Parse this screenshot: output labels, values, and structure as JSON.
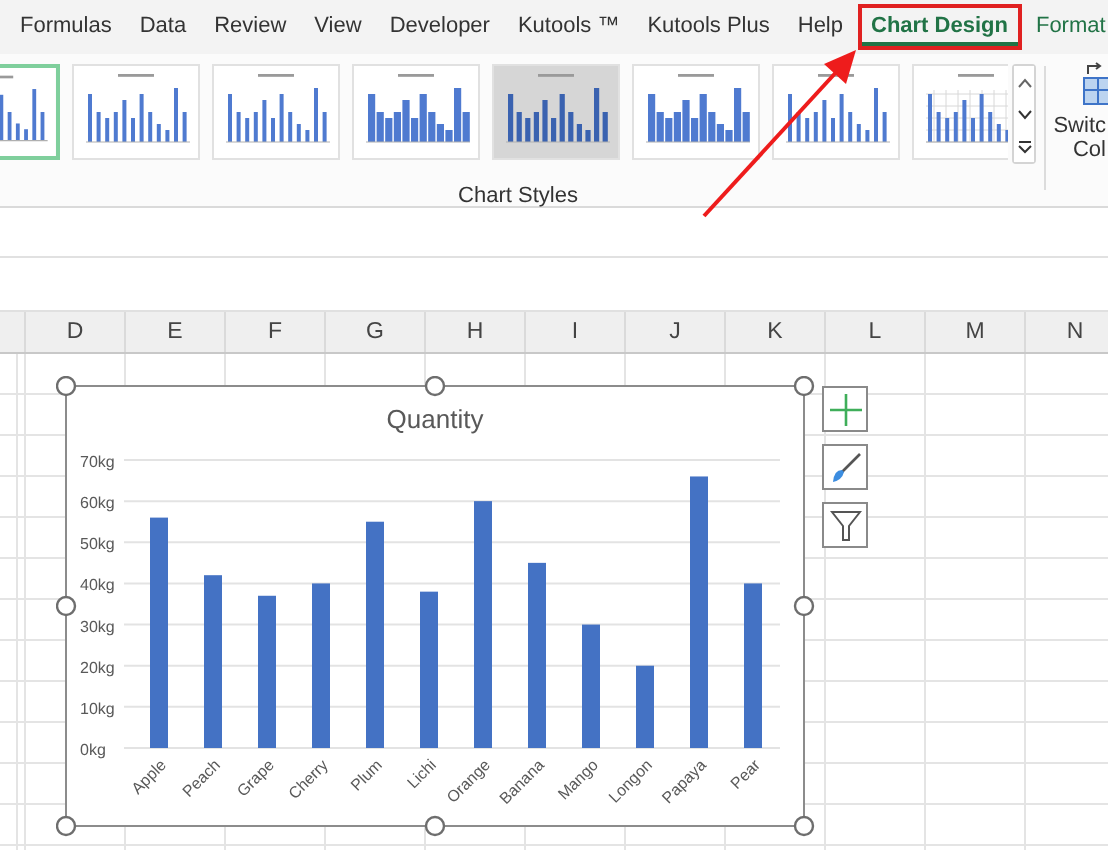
{
  "ribbon": {
    "tabs": [
      {
        "label": "Formulas",
        "selected": false,
        "contextual": false,
        "highlighted": false
      },
      {
        "label": "Data",
        "selected": false,
        "contextual": false,
        "highlighted": false
      },
      {
        "label": "Review",
        "selected": false,
        "contextual": false,
        "highlighted": false
      },
      {
        "label": "View",
        "selected": false,
        "contextual": false,
        "highlighted": false
      },
      {
        "label": "Developer",
        "selected": false,
        "contextual": false,
        "highlighted": false
      },
      {
        "label": "Kutools ™",
        "selected": false,
        "contextual": false,
        "highlighted": false
      },
      {
        "label": "Kutools Plus",
        "selected": false,
        "contextual": false,
        "highlighted": false
      },
      {
        "label": "Help",
        "selected": false,
        "contextual": false,
        "highlighted": false
      },
      {
        "label": "Chart Design",
        "selected": true,
        "contextual": true,
        "highlighted": true
      },
      {
        "label": "Format",
        "selected": false,
        "contextual": true,
        "highlighted": false
      }
    ],
    "chart_styles": {
      "group_label": "Chart Styles",
      "styles": [
        {
          "kind": "thin",
          "selected": true
        },
        {
          "kind": "thin",
          "selected": false
        },
        {
          "kind": "thin",
          "selected": false
        },
        {
          "kind": "wide",
          "selected": false
        },
        {
          "kind": "shaded",
          "selected": false
        },
        {
          "kind": "wide",
          "selected": false
        },
        {
          "kind": "thin",
          "selected": false
        },
        {
          "kind": "grid",
          "selected": false
        }
      ]
    },
    "switch_button": {
      "line_1": "Switc",
      "line_2": "Col"
    }
  },
  "sheet": {
    "columns": [
      "D",
      "E",
      "F",
      "G",
      "H",
      "I",
      "J",
      "K",
      "L",
      "M",
      "N"
    ],
    "chart_buttons": [
      {
        "kind": "add"
      },
      {
        "kind": "brush"
      },
      {
        "kind": "filter"
      }
    ],
    "chart_data": {
      "type": "bar",
      "title": "Quantity",
      "categories": [
        "Apple",
        "Peach",
        "Grape",
        "Cherry",
        "Plum",
        "Lichi",
        "Orange",
        "Banana",
        "Mango",
        "Longon",
        "Papaya",
        "Pear"
      ],
      "grid": true,
      "series": [
        {
          "color": "#4472c4",
          "values": [
            56,
            42,
            37,
            40,
            55,
            38,
            60,
            45,
            30,
            20,
            66,
            40
          ]
        }
      ],
      "ylim": [
        0,
        70
      ],
      "yticks": [
        {
          "value": 0,
          "label": "0kg"
        },
        {
          "value": 10,
          "label": "10kg"
        },
        {
          "value": 20,
          "label": "20kg"
        },
        {
          "value": 30,
          "label": "30kg"
        },
        {
          "value": 40,
          "label": "40kg"
        },
        {
          "value": 50,
          "label": "50kg"
        },
        {
          "value": 60,
          "label": "60kg"
        },
        {
          "value": 70,
          "label": "70kg"
        }
      ]
    }
  }
}
